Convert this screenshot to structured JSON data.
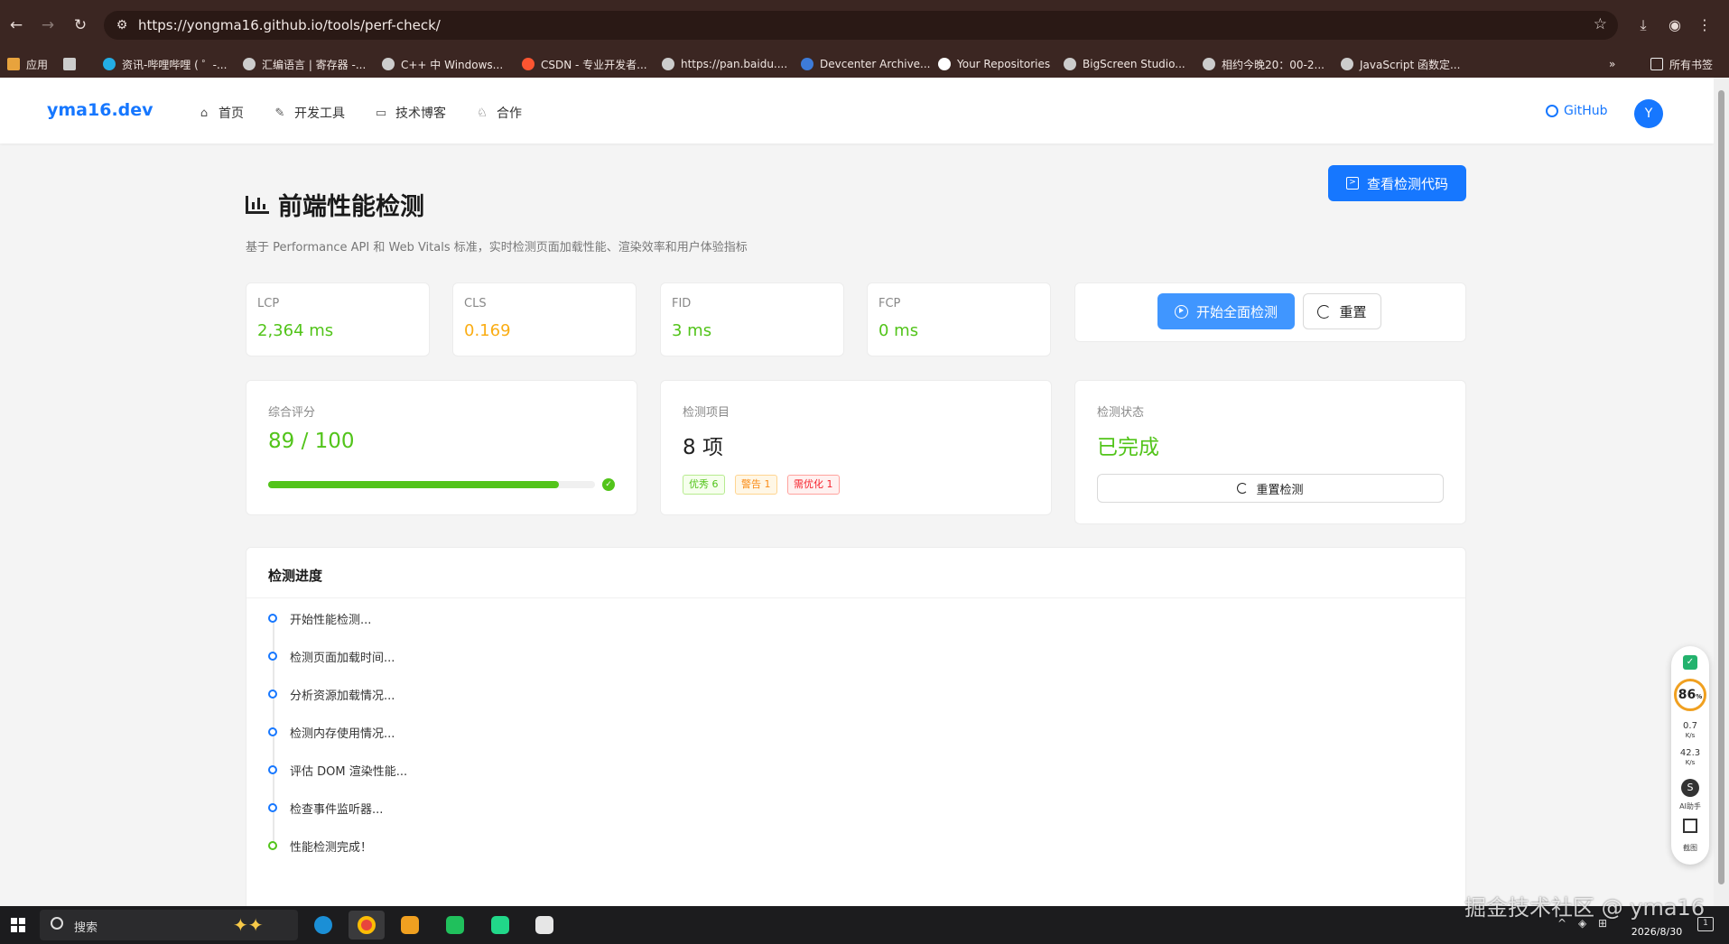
{
  "browser": {
    "url": "https://yongma16.github.io/tools/perf-check/",
    "bookmarks": [
      {
        "label": "应用",
        "color": "#e8a33d"
      },
      {
        "label": "",
        "color": "#cccccc"
      },
      {
        "label": "资讯-哔哩哔哩 ( ゜-...",
        "color": "#23ade5"
      },
      {
        "label": "汇编语言 | 寄存器 -...",
        "color": "#cccccc"
      },
      {
        "label": "C++ 中 Windows...",
        "color": "#cccccc"
      },
      {
        "label": "CSDN - 专业开发者...",
        "color": "#fc5531"
      },
      {
        "label": "https://pan.baidu....",
        "color": "#cccccc"
      },
      {
        "label": "Devcenter Archive...",
        "color": "#3d7bd9"
      },
      {
        "label": "Your Repositories",
        "color": "#ffffff"
      },
      {
        "label": "BigScreen Studio...",
        "color": "#cccccc"
      },
      {
        "label": "相约今晚20：00-2...",
        "color": "#cccccc"
      },
      {
        "label": "JavaScript 函数定...",
        "color": "#cccccc"
      }
    ],
    "more": "»",
    "all_bookmarks": "所有书签"
  },
  "site": {
    "logo": "yma16.dev",
    "nav": [
      {
        "label": "首页",
        "icon": "⌂"
      },
      {
        "label": "开发工具",
        "icon": "✎"
      },
      {
        "label": "技术博客",
        "icon": "▭"
      },
      {
        "label": "合作",
        "icon": "♘"
      }
    ],
    "github": "GitHub",
    "avatar": "Y"
  },
  "page": {
    "view_code": "查看检测代码",
    "title": "前端性能检测",
    "subtitle": "基于 Performance API 和 Web Vitals 标准，实时检测页面加载性能、渲染效率和用户体验指标",
    "metrics": [
      {
        "label": "LCP",
        "value": "2,364 ms",
        "color": "#52c41a"
      },
      {
        "label": "CLS",
        "value": "0.169",
        "color": "#faad14"
      },
      {
        "label": "FID",
        "value": "3 ms",
        "color": "#52c41a"
      },
      {
        "label": "FCP",
        "value": "0 ms",
        "color": "#52c41a"
      }
    ],
    "start_btn": "开始全面检测",
    "reset_btn": "重置",
    "score": {
      "label": "综合评分",
      "value": "89 / 100",
      "percent": 89,
      "color": "#52c41a"
    },
    "items": {
      "label": "检测项目",
      "value": "8 项",
      "tags": [
        {
          "label": "优秀 6",
          "type": "green"
        },
        {
          "label": "警告 1",
          "type": "orange"
        },
        {
          "label": "需优化 1",
          "type": "red"
        }
      ]
    },
    "status": {
      "label": "检测状态",
      "value": "已完成",
      "color": "#52c41a",
      "redo": "重置检测"
    },
    "progress": {
      "title": "检测进度",
      "steps": [
        {
          "text": "开始性能检测...",
          "done": false
        },
        {
          "text": "检测页面加载时间...",
          "done": false
        },
        {
          "text": "分析资源加载情况...",
          "done": false
        },
        {
          "text": "检测内存使用情况...",
          "done": false
        },
        {
          "text": "评估 DOM 渲染性能...",
          "done": false
        },
        {
          "text": "检查事件监听器...",
          "done": false
        },
        {
          "text": "性能检测完成！",
          "done": true
        }
      ]
    }
  },
  "widget": {
    "score": "86",
    "unit": "%",
    "up": "0.7",
    "up_unit": "K/s",
    "down": "42.3",
    "down_unit": "K/s",
    "ai_label": "AI助手",
    "capture_label": "截图"
  },
  "taskbar": {
    "search": "搜索",
    "date": "2026/8/30",
    "notifications": "1"
  },
  "watermark": "掘金技术社区 @ yma16"
}
